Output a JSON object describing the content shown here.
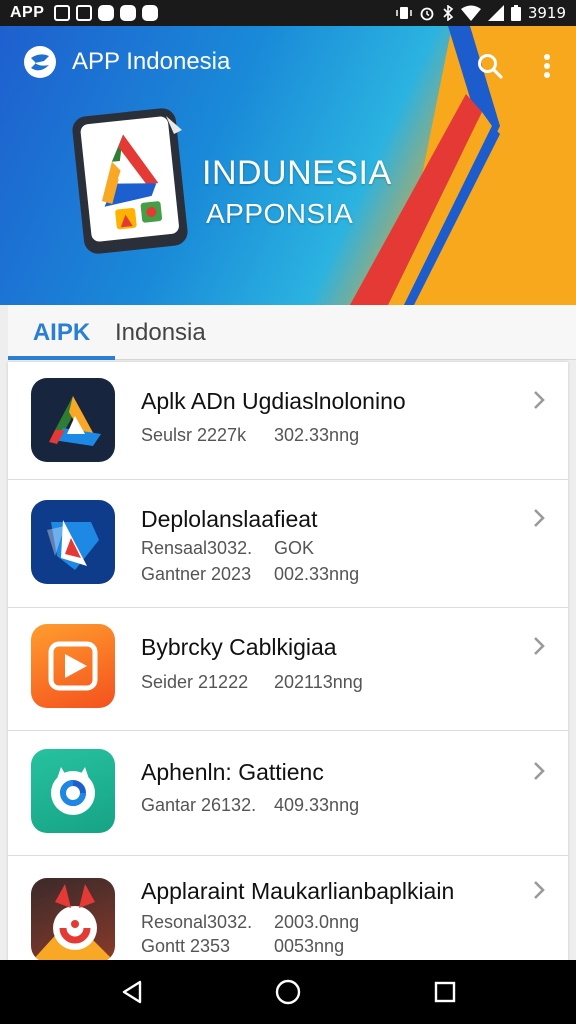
{
  "status_bar": {
    "app_label": "APP",
    "time": "3919"
  },
  "header": {
    "title": "APP Indonesia",
    "hero_line1": "INDUNESIA",
    "hero_line2": "APPONSIA",
    "accent_colors": [
      "#1e5fcf",
      "#2bb3e0",
      "#f7a81d",
      "#e53935"
    ]
  },
  "tabs": [
    {
      "label": "AIPK",
      "active": true,
      "color": "#2a7fd4"
    },
    {
      "label": "Indonsia",
      "active": false
    }
  ],
  "apps": [
    {
      "name": "Aplk ADn Ugdiaslnolonino",
      "meta": [
        [
          "Seulsr 2227k",
          "302.33nng"
        ]
      ],
      "icon": "drive-triangle-icon"
    },
    {
      "name": "Deplolanslaafieat",
      "meta": [
        [
          "Rensaal3032.",
          "GOK"
        ],
        [
          "Gantner 2023",
          "002.33nng"
        ]
      ],
      "icon": "star-triangle-icon"
    },
    {
      "name": "Bybrcky Cablkigiaa",
      "meta": [
        [
          "Seider 21222",
          "202113nng"
        ]
      ],
      "icon": "play-icon"
    },
    {
      "name": "Aphenln: Gattienc",
      "meta": [
        [
          "Gantar 26132.",
          "409.33nng"
        ]
      ],
      "icon": "swirl-icon"
    },
    {
      "name": "Applaraint Maukarlianbaplkiain",
      "meta": [
        [
          "Resonal3032.",
          "2003.0nng"
        ],
        [
          "Gontt 2353",
          "0053nng"
        ]
      ],
      "icon": "fox-icon"
    }
  ]
}
